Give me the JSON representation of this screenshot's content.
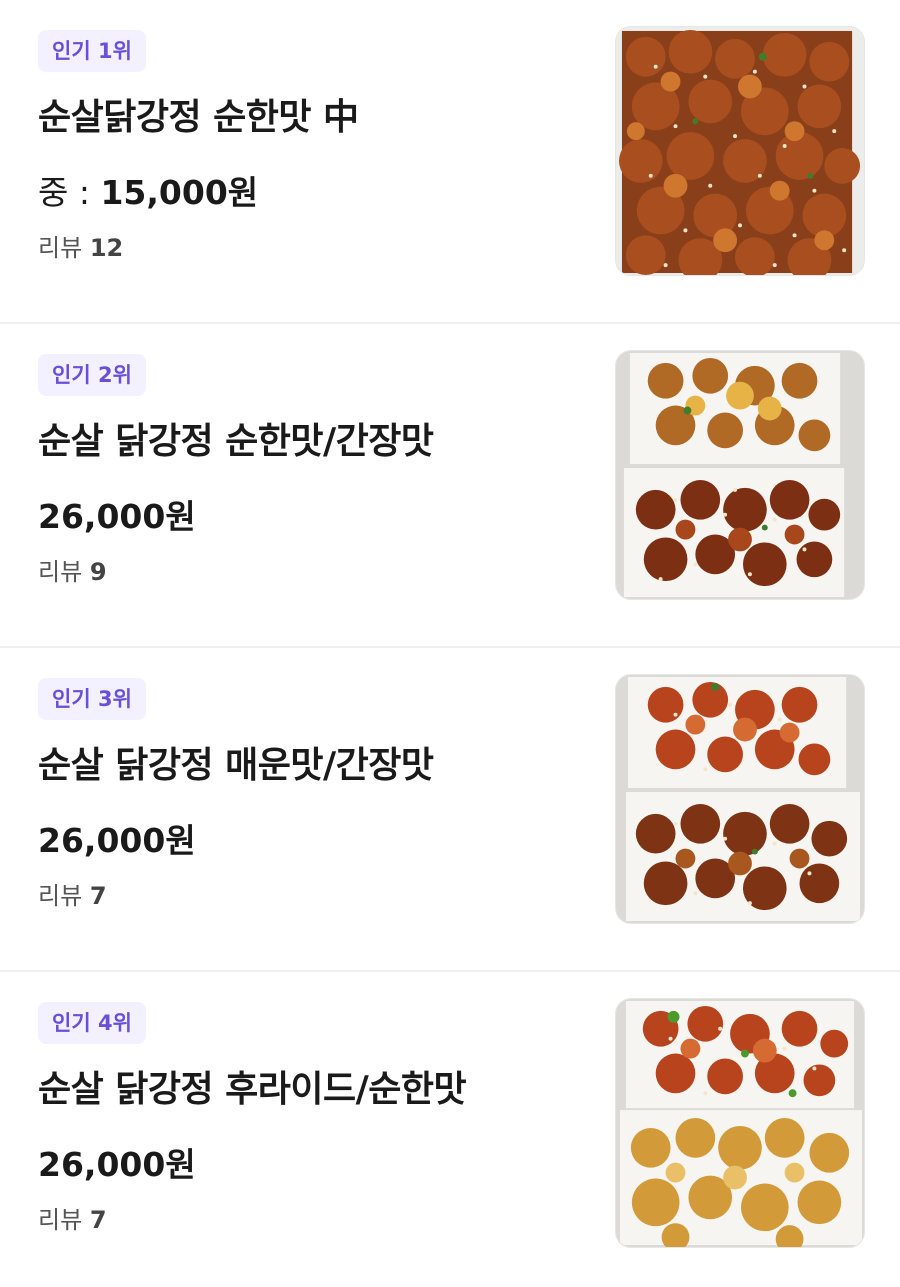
{
  "menu_items": [
    {
      "badge": "인기 1위",
      "title": "순살닭강정 순한맛 中",
      "price_prefix": "중 : ",
      "price": "15,000원",
      "review_label": "리뷰",
      "review_count": "12",
      "photo_icon": "fried-chicken-single-tray-photo"
    },
    {
      "badge": "인기 2위",
      "title": "순살 닭강정 순한맛/간장맛",
      "price_prefix": "",
      "price": "26,000원",
      "review_label": "리뷰",
      "review_count": "9",
      "photo_icon": "fried-chicken-two-trays-photo"
    },
    {
      "badge": "인기 3위",
      "title": "순살 닭강정 매운맛/간장맛",
      "price_prefix": "",
      "price": "26,000원",
      "review_label": "리뷰",
      "review_count": "7",
      "photo_icon": "fried-chicken-two-trays-photo"
    },
    {
      "badge": "인기 4위",
      "title": "순살 닭강정 후라이드/순한맛",
      "price_prefix": "",
      "price": "26,000원",
      "review_label": "리뷰",
      "review_count": "7",
      "photo_icon": "fried-chicken-two-trays-photo"
    }
  ],
  "colors": {
    "badge_bg": "#f3f1ff",
    "badge_text": "#6a4fd8",
    "divider": "#efefef",
    "title_text": "#1a1a1a",
    "review_text": "#555555"
  }
}
